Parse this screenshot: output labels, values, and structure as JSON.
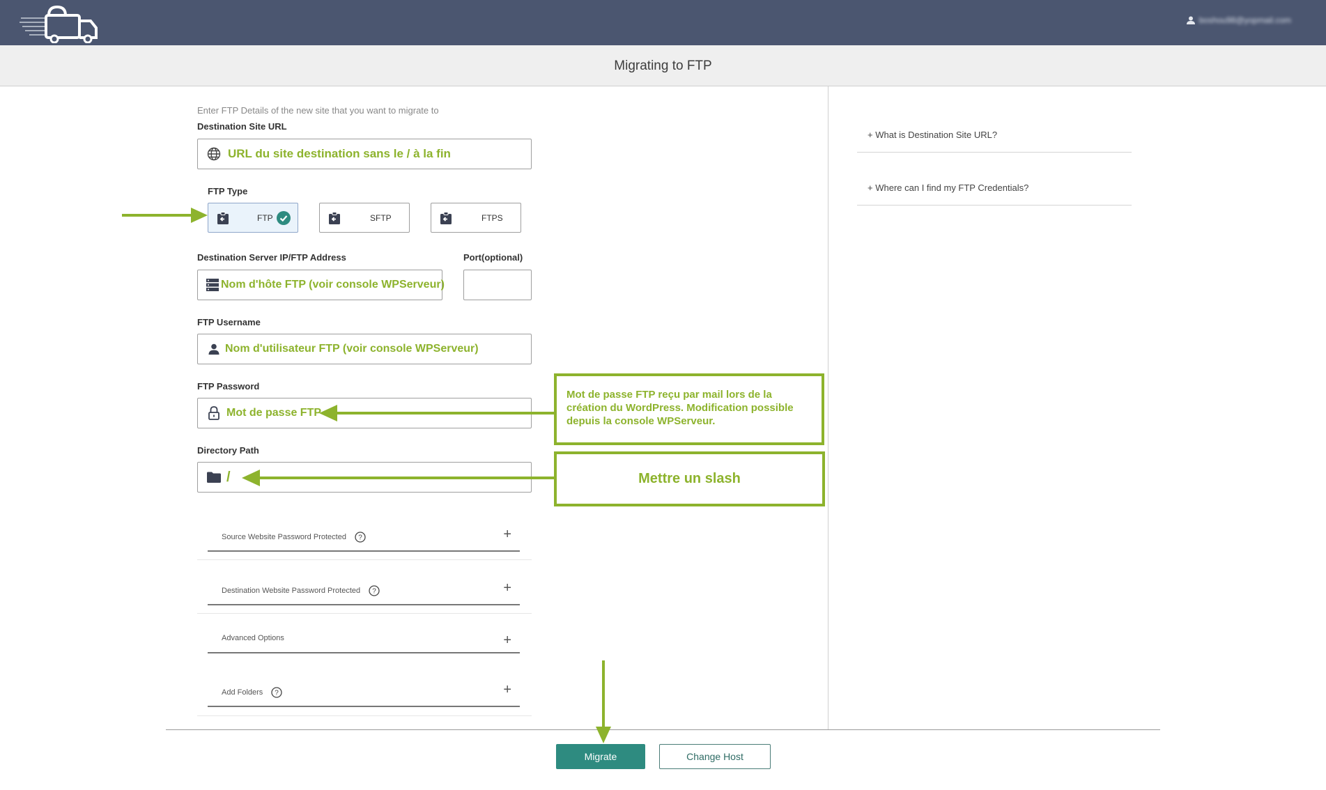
{
  "header": {
    "user_email": "boshou98@yopmail.com",
    "logo": "truck-logo-icon",
    "user_icon": "user-icon"
  },
  "page_title": "Migrating to FTP",
  "form": {
    "intro": "Enter FTP Details of the new site that you want to migrate to",
    "destination_url": {
      "label": "Destination Site URL",
      "value": "URL du site destination sans le / à la fin",
      "icon": "globe-icon"
    },
    "ftp_type": {
      "label": "FTP Type",
      "options": [
        {
          "label": "FTP",
          "selected": true
        },
        {
          "label": "SFTP",
          "selected": false
        },
        {
          "label": "FTPS",
          "selected": false
        }
      ]
    },
    "server_address": {
      "label": "Destination Server IP/FTP Address",
      "value": "Nom d'hôte FTP (voir console WPServeur)",
      "icon": "server-icon"
    },
    "port": {
      "label": "Port(optional)",
      "value": ""
    },
    "username": {
      "label": "FTP Username",
      "value": "Nom d'utilisateur FTP (voir console WPServeur)",
      "icon": "user-icon"
    },
    "password": {
      "label": "FTP Password",
      "value": "Mot de passe FTP",
      "icon": "lock-icon"
    },
    "directory": {
      "label": "Directory Path",
      "value": "/",
      "icon": "folder-icon"
    },
    "accordions": [
      {
        "label": "Source Website Password Protected",
        "help": true
      },
      {
        "label": "Destination Website Password Protected",
        "help": true
      },
      {
        "label": "Advanced Options",
        "help": false
      },
      {
        "label": "Add Folders",
        "help": true
      }
    ]
  },
  "sidebar": {
    "faq": [
      {
        "label": "What is Destination Site URL?"
      },
      {
        "label": "Where can I find my FTP Credentials?"
      }
    ]
  },
  "annotations": {
    "password_note": "Mot de passe FTP reçu par mail lors de la création du WordPress. Modification possible depuis la console WPServeur.",
    "slash_note": "Mettre un slash"
  },
  "buttons": {
    "migrate": "Migrate",
    "change_host": "Change Host"
  },
  "colors": {
    "header_bg": "#4b5670",
    "annotation": "#8db32d",
    "primary": "#2e8b80"
  }
}
